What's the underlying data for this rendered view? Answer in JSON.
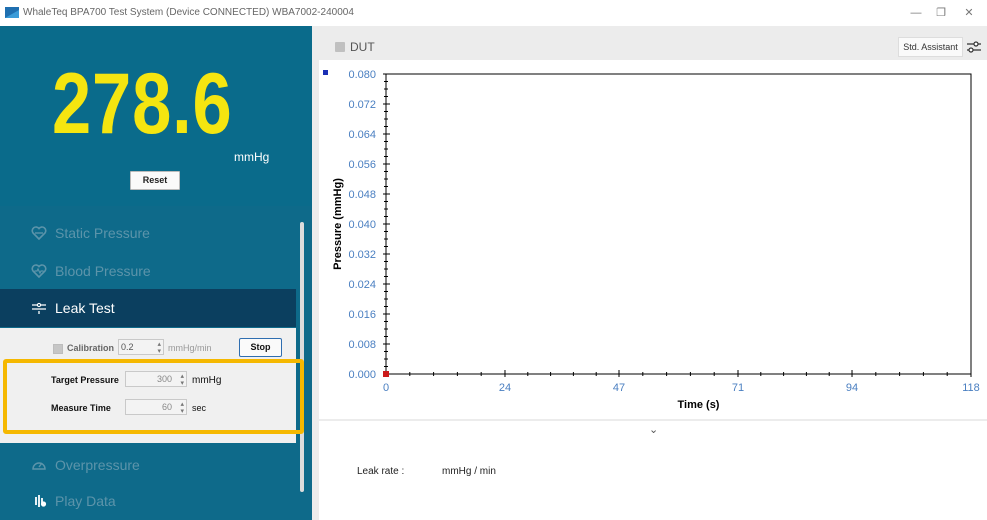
{
  "window": {
    "title": "WhaleTeq BPA700 Test System (Device CONNECTED)   WBA7002-240004",
    "min_glyph": "—",
    "restore_glyph": "❐",
    "close_glyph": "✕"
  },
  "display": {
    "value": "278.6",
    "unit": "mmHg",
    "reset_label": "Reset",
    "value_color": "#f5e510"
  },
  "nav": {
    "items": [
      {
        "label": "Static Pressure",
        "icon": "heart-pressure-icon",
        "state": "inactive"
      },
      {
        "label": "Blood Pressure",
        "icon": "heart-pulse-icon",
        "state": "inactive"
      },
      {
        "label": "Leak Test",
        "icon": "leak-icon",
        "state": "active"
      },
      {
        "label": "Overpressure",
        "icon": "gauge-icon",
        "state": "inactive"
      },
      {
        "label": "Play Data",
        "icon": "waveform-icon",
        "state": "inactive"
      }
    ]
  },
  "leak_test": {
    "calibration_label": "Calibration",
    "calibration_value": "0.2",
    "calibration_unit": "mmHg/min",
    "stop_label": "Stop",
    "target_pressure_label": "Target Pressure",
    "target_pressure_value": "300",
    "target_pressure_unit": "mmHg",
    "measure_time_label": "Measure Time",
    "measure_time_value": "60",
    "measure_time_unit": "sec"
  },
  "toolbar": {
    "dut_label": "DUT",
    "assistant_label": "Std. Assistant"
  },
  "chart_data": {
    "type": "line",
    "title": "",
    "xlabel": "Time (s)",
    "ylabel": "Pressure (mmHg)",
    "x_ticks": [
      "0",
      "24",
      "47",
      "71",
      "94",
      "118"
    ],
    "y_ticks": [
      "0.000",
      "0.008",
      "0.016",
      "0.024",
      "0.032",
      "0.040",
      "0.048",
      "0.056",
      "0.064",
      "0.072",
      "0.080"
    ],
    "xlim": [
      0,
      118
    ],
    "ylim": [
      0,
      0.08
    ],
    "series": [
      {
        "color": "#1a2fb5",
        "x": [],
        "y": []
      }
    ],
    "marker": {
      "x": 0,
      "y": 0,
      "color": "#cc1a1a"
    },
    "grid": false,
    "tick_color": "#4a7fc1"
  },
  "result": {
    "leak_rate_label": "Leak rate :",
    "leak_rate_unit": "mmHg / min",
    "expand_glyph": "⌄"
  }
}
